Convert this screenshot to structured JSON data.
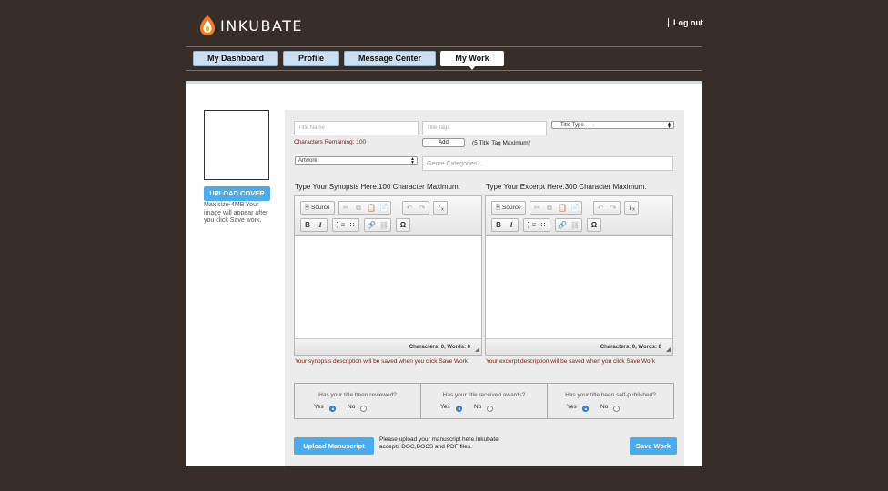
{
  "brand": {
    "name": "INKUBATE",
    "logout": "Log out"
  },
  "tabs": [
    {
      "label": "My Dashboard",
      "active": false
    },
    {
      "label": "Profile",
      "active": false
    },
    {
      "label": "Message Center",
      "active": false
    },
    {
      "label": "My Work",
      "active": true
    }
  ],
  "cover": {
    "upload_label": "UPLOAD COVER",
    "note": "Max size-4MB Your image will appear after you click Save work."
  },
  "form": {
    "title_name_placeholder": "Title Name",
    "title_name_value": "",
    "title_tags_placeholder": "Title Tags",
    "title_tags_value": "",
    "chars_remaining": "Characters Remaining: 100",
    "add_label": "Add",
    "tag_max": "(5 Title Tag Maximum)",
    "title_type": {
      "selected": "---Title Type----"
    },
    "category": {
      "selected": "Artwork"
    },
    "genre_placeholder": "Genre Categories..."
  },
  "synopsis": {
    "heading": "Type Your Synopsis Here.100 Character Maximum.",
    "source_label": "Source",
    "counter": "Characters: 0, Words: 0",
    "note": "Your synopsis description will be saved when you click Save Work"
  },
  "excerpt": {
    "heading": "Type Your Excerpt Here.300 Character Maximum.",
    "source_label": "Source",
    "counter": "Characters: 0, Words: 0",
    "note": "Your excerpt description will be saved when you click Save Work"
  },
  "questions": [
    {
      "text": "Has your title been reviewed?",
      "yes": "Yes",
      "no": "No",
      "selected": "Yes"
    },
    {
      "text": "Has your title received awards?",
      "yes": "Yes",
      "no": "No",
      "selected": "Yes"
    },
    {
      "text": "Has your title been self-published?",
      "yes": "Yes",
      "no": "No",
      "selected": "Yes"
    }
  ],
  "manuscript": {
    "upload_label": "Upload Manuscript",
    "note": "Please upload your manuscript here.Inkubate accepts DOC,DOCS and PDF files."
  },
  "save_label": "Save Work",
  "colors": {
    "background": "#382e29",
    "accent_blue": "#4aacec",
    "tab_blue": "#c9dff2",
    "note_red": "#7a1a1a"
  }
}
